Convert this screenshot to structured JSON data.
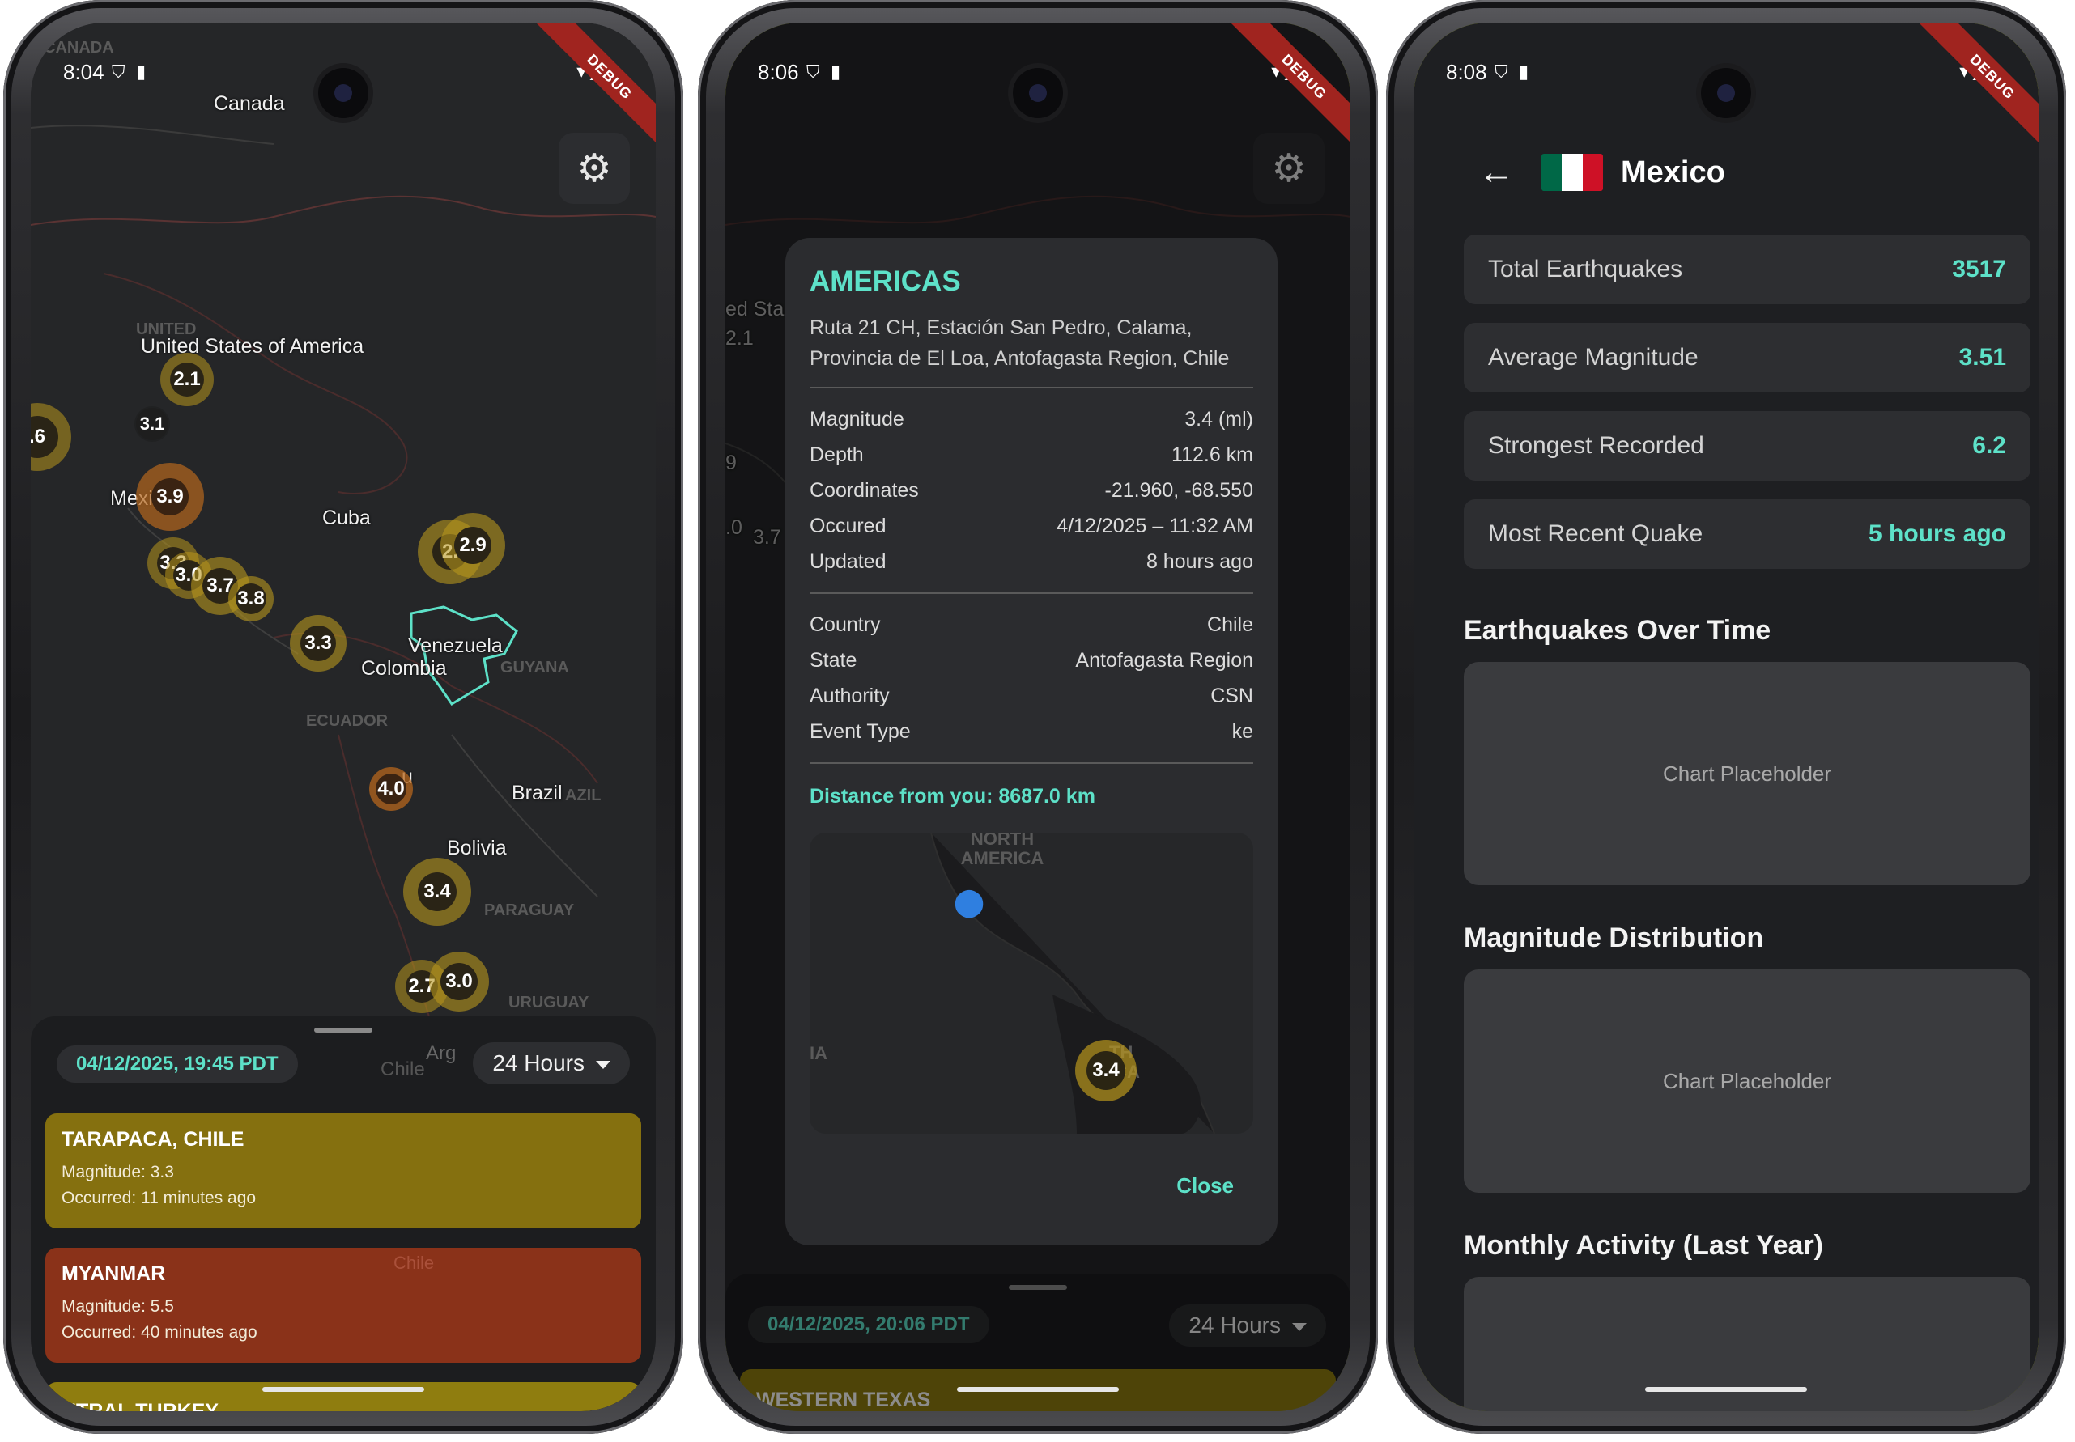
{
  "phone1": {
    "status_time": "8:04",
    "debug_banner": "DEBUG",
    "map_labels": {
      "canada": "Canada",
      "usa": "United States of America",
      "mexico": "Mexi",
      "cuba": "Cuba",
      "venezuela": "Venezuela",
      "colombia": "Colombia",
      "brazil": "Brazil",
      "bolivia": "Bolivia",
      "peru": "u",
      "argentina": "Arg",
      "chile_sheet": "Chile",
      "chile_card": "Chile"
    },
    "ghost_labels": {
      "canada": "CANADA",
      "united": "UNITED",
      "ecuador": "ECUADOR",
      "paraguay": "PARAGUAY",
      "uruguay": "URUGUAY",
      "guyana": "GUYANA",
      "brazil_caps": "AZIL"
    },
    "quakes": [
      "2.1",
      "3.1",
      "2.",
      ".6",
      "3.9",
      "3.3",
      "3.0",
      "3.7",
      "3.8",
      "3.3",
      "2.9",
      "2.",
      "4.0",
      "3.4",
      "2.7",
      "3.0"
    ],
    "sheet": {
      "date": "04/12/2025, 19:45 PDT",
      "range": "24 Hours",
      "cards": [
        {
          "title": "TARAPACA, CHILE",
          "magnitude": "Magnitude: 3.3",
          "occurred": "Occurred: 11 minutes ago",
          "color": "#85700f"
        },
        {
          "title": "MYANMAR",
          "magnitude": "Magnitude: 5.5",
          "occurred": "Occurred: 40 minutes ago",
          "color": "#8a3219"
        },
        {
          "title": "NTRAL TURKEY",
          "color": "#8f7d0f"
        }
      ]
    }
  },
  "phone2": {
    "status_time": "8:06",
    "debug_banner": "DEBUG",
    "map_bg_labels": {
      "sta": "ed Sta",
      "q1": "2.1",
      "q2": "9",
      "q3": ".0",
      "q4": "3.7"
    },
    "dialog": {
      "title": "AMERICAS",
      "address": "Ruta 21 CH, Estación San Pedro, Calama, Provincia de El Loa, Antofagasta Region, Chile",
      "rows1": [
        {
          "k": "Magnitude",
          "v": "3.4 (ml)"
        },
        {
          "k": "Depth",
          "v": "112.6 km"
        },
        {
          "k": "Coordinates",
          "v": "-21.960, -68.550"
        },
        {
          "k": "Occured",
          "v": "4/12/2025 – 11:32 AM"
        },
        {
          "k": "Updated",
          "v": "8 hours ago"
        }
      ],
      "rows2": [
        {
          "k": "Country",
          "v": "Chile"
        },
        {
          "k": "State",
          "v": "Antofagasta Region"
        },
        {
          "k": "Authority",
          "v": "CSN"
        },
        {
          "k": "Event Type",
          "v": "ke"
        }
      ],
      "distance": "Distance from you: 8687.0 km",
      "mini_map": {
        "north_america": "NORTH AMERICA",
        "south_america": "TH ICA",
        "left_label": "IA",
        "quake": "3.4"
      },
      "close": "Close"
    },
    "sheet": {
      "date": "04/12/2025, 20:06 PDT",
      "range": "24 Hours",
      "card": "WESTERN TEXAS"
    }
  },
  "phone3": {
    "status_time": "8:08",
    "debug_banner": "DEBUG",
    "title": "Mexico",
    "flag_colors": [
      "#006847",
      "#ffffff",
      "#ce1126"
    ],
    "stats": [
      {
        "k": "Total Earthquakes",
        "v": "3517"
      },
      {
        "k": "Average Magnitude",
        "v": "3.51"
      },
      {
        "k": "Strongest Recorded",
        "v": "6.2"
      },
      {
        "k": "Most Recent Quake",
        "v": "5 hours ago"
      }
    ],
    "sections": [
      {
        "title": "Earthquakes Over Time",
        "placeholder": "Chart Placeholder"
      },
      {
        "title": "Magnitude Distribution",
        "placeholder": "Chart Placeholder"
      },
      {
        "title": "Monthly Activity (Last Year)"
      }
    ]
  },
  "colors": {
    "accent": "#5de1c8",
    "quake_ring": "#b8961c",
    "quake_ring_orange": "#b5661c",
    "border_highlight": "#c6d62a"
  }
}
